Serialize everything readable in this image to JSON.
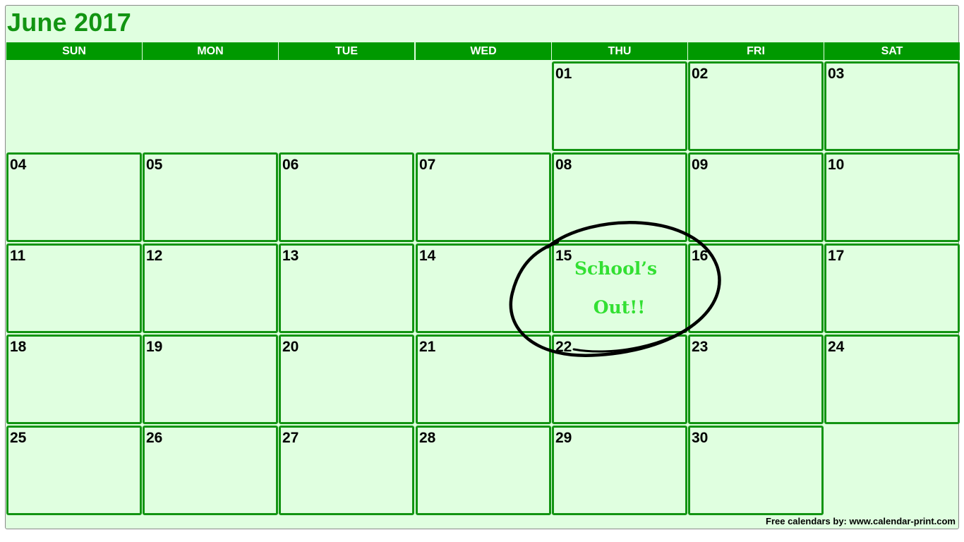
{
  "calendar": {
    "title": "June 2017",
    "weekdays": [
      "SUN",
      "MON",
      "TUE",
      "WED",
      "THU",
      "FRI",
      "SAT"
    ],
    "days": [
      "01",
      "02",
      "03",
      "04",
      "05",
      "06",
      "07",
      "08",
      "09",
      "10",
      "11",
      "12",
      "13",
      "14",
      "15",
      "16",
      "17",
      "18",
      "19",
      "20",
      "21",
      "22",
      "23",
      "24",
      "25",
      "26",
      "27",
      "28",
      "29",
      "30"
    ],
    "first_weekday_index": 4,
    "note": {
      "line1": "School’s",
      "line2": "Out!!",
      "day": "15",
      "color": "#33e033"
    },
    "footer": "Free calendars by: www.calendar-print.com"
  },
  "colors": {
    "header_green": "#009900",
    "border_green": "#129412",
    "cell_bg": "#e0ffe0"
  }
}
